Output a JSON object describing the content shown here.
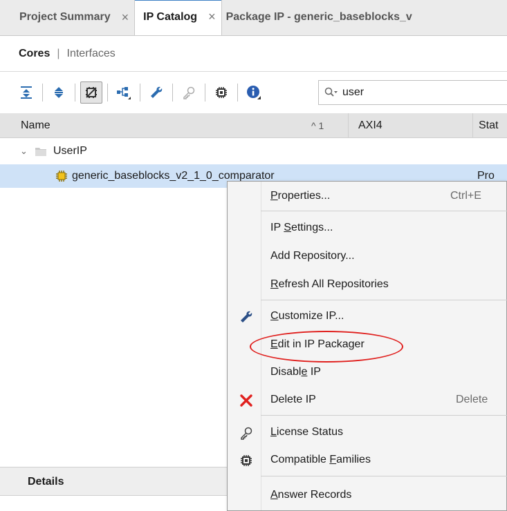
{
  "tabs": [
    {
      "label": "Project Summary",
      "close": "×",
      "active": false
    },
    {
      "label": "IP Catalog",
      "close": "×",
      "active": true
    },
    {
      "label": "Package IP - generic_baseblocks_v",
      "close": "",
      "active": false
    }
  ],
  "subtabs": {
    "cores": "Cores",
    "separator": "|",
    "interfaces": "Interfaces"
  },
  "toolbar": {
    "buttons": [
      "collapse-all",
      "expand-all",
      "show-compatible",
      "hierarchy",
      "customize",
      "license",
      "chip",
      "info"
    ],
    "search_value": "user"
  },
  "table": {
    "columns": {
      "name": "Name",
      "sort_indicator": "^ 1",
      "axi4": "AXI4",
      "status": "Stat"
    },
    "group": {
      "chevron": "⌄",
      "label": "UserIP"
    },
    "item": {
      "label": "generic_baseblocks_v2_1_0_comparator",
      "status": "Pro"
    }
  },
  "details": {
    "label": "Details"
  },
  "context_menu": {
    "properties": {
      "pre": "",
      "u": "P",
      "post": "roperties...",
      "shortcut": "Ctrl+E"
    },
    "ip_settings": {
      "pre": "IP ",
      "u": "S",
      "post": "ettings..."
    },
    "add_repository": {
      "pre": "Add Repository...",
      "u": "",
      "post": ""
    },
    "refresh_all": {
      "pre": "",
      "u": "R",
      "post": "efresh All Repositories"
    },
    "customize_ip": {
      "pre": "",
      "u": "C",
      "post": "ustomize IP..."
    },
    "edit_in_packager": {
      "pre": "",
      "u": "E",
      "post": "dit in IP Packager"
    },
    "disable_ip": {
      "pre": "Disabl",
      "u": "e",
      "post": " IP"
    },
    "delete_ip": {
      "pre": "Delete IP",
      "u": "",
      "post": "",
      "shortcut": "Delete"
    },
    "license_status": {
      "pre": "",
      "u": "L",
      "post": "icense Status"
    },
    "compatible_families": {
      "pre": "Compatible ",
      "u": "F",
      "post": "amilies"
    },
    "answer_records": {
      "pre": "",
      "u": "A",
      "post": "nswer Records"
    }
  },
  "colors": {
    "selection": "#cfe2f7",
    "highlight_ellipse": "#e0201e",
    "delete_icon": "#e0201e"
  }
}
